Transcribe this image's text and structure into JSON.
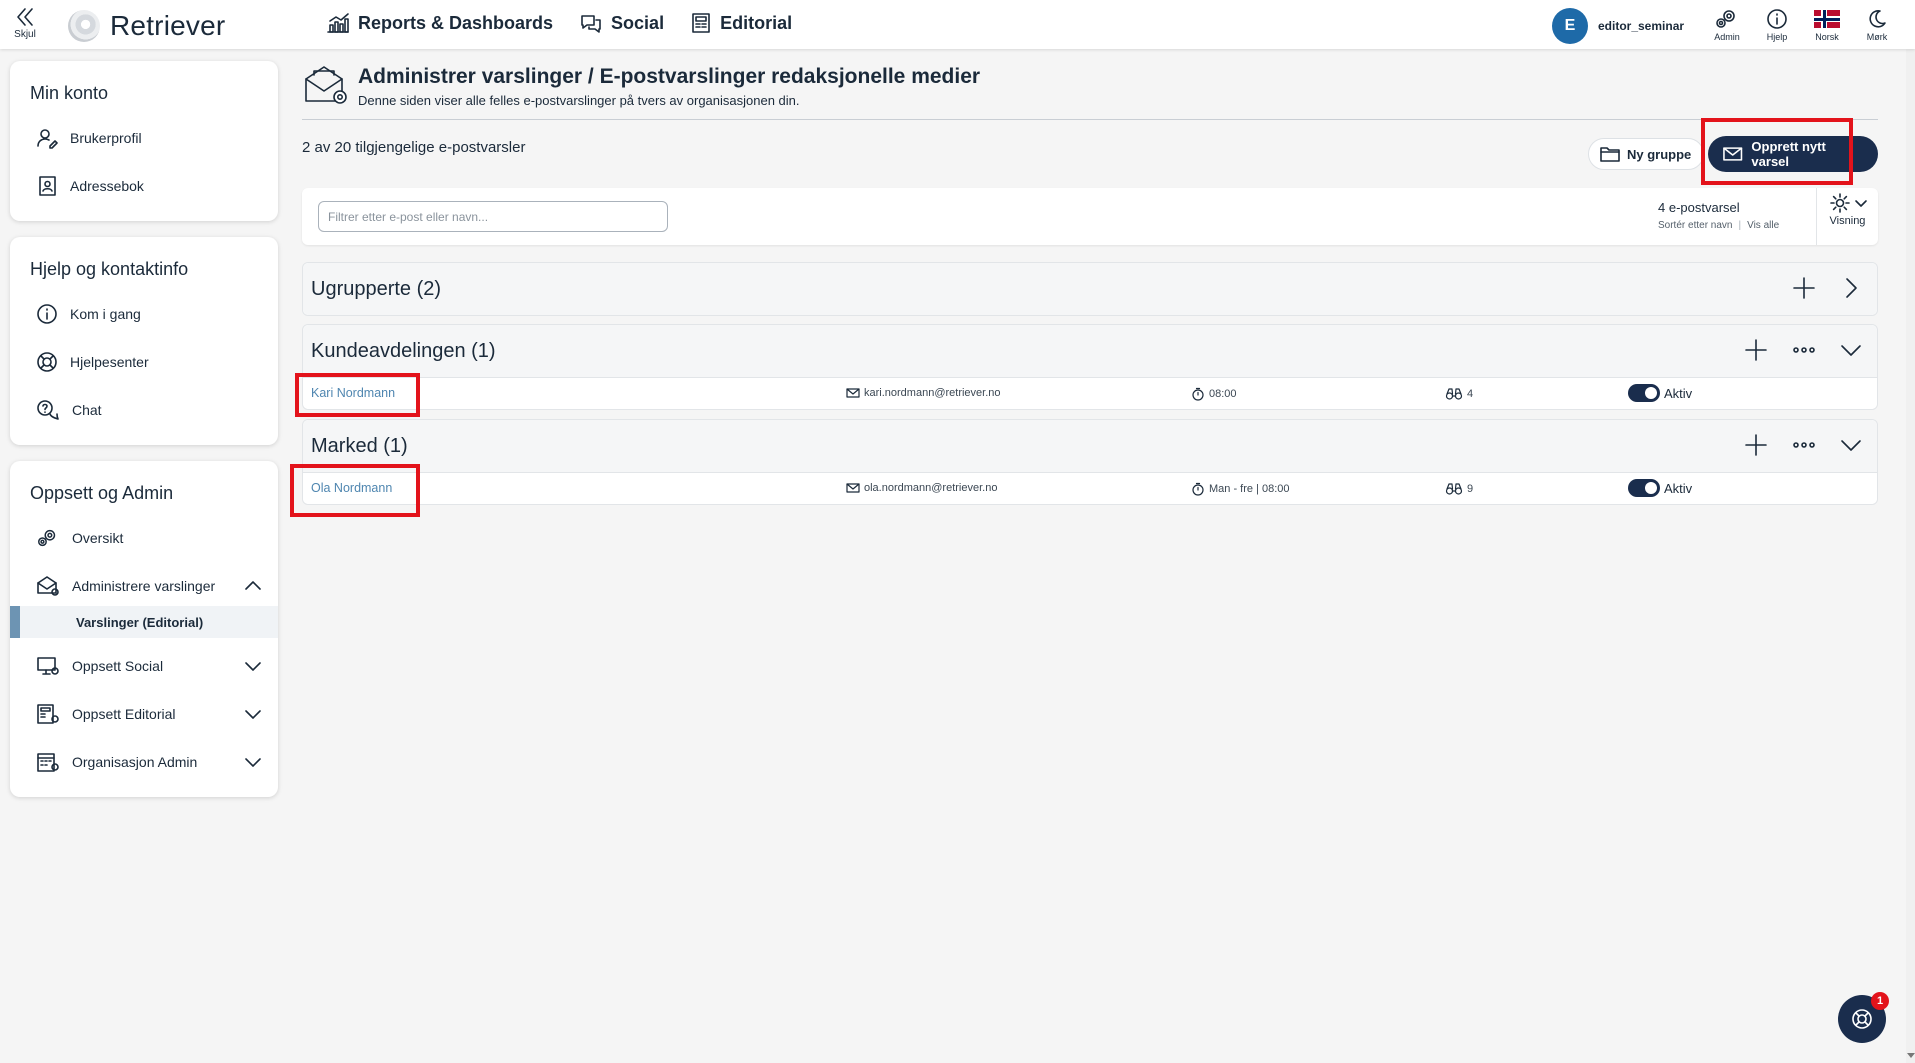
{
  "topbar": {
    "hide_label": "Skjul",
    "brand": "Retriever",
    "nav": [
      {
        "label": "Reports & Dashboards",
        "icon": "chart-icon"
      },
      {
        "label": "Social",
        "icon": "chat-bubbles-icon"
      },
      {
        "label": "Editorial",
        "icon": "newspaper-icon"
      }
    ],
    "user_initial": "E",
    "username": "editor_seminar",
    "actions": [
      {
        "label": "Admin",
        "icon": "gears-icon"
      },
      {
        "label": "Hjelp",
        "icon": "info-icon"
      },
      {
        "label": "Norsk",
        "icon": "norway-flag-icon"
      },
      {
        "label": "Mørk",
        "icon": "moon-icon"
      }
    ]
  },
  "sidebar": {
    "account": {
      "title": "Min konto",
      "items": [
        {
          "label": "Brukerprofil",
          "icon": "user-edit-icon"
        },
        {
          "label": "Adressebok",
          "icon": "address-book-icon"
        }
      ]
    },
    "help": {
      "title": "Hjelp og kontaktinfo",
      "items": [
        {
          "label": "Kom i gang",
          "icon": "info-icon"
        },
        {
          "label": "Hjelpesenter",
          "icon": "lifebuoy-icon"
        },
        {
          "label": "Chat",
          "icon": "chat-question-icon"
        }
      ]
    },
    "admin": {
      "title": "Oppsett og Admin",
      "items": [
        {
          "label": "Oversikt",
          "icon": "gears-icon"
        },
        {
          "label": "Administrere varslinger",
          "icon": "mail-gear-icon"
        },
        {
          "label": "Varslinger (Editorial)"
        },
        {
          "label": "Oppsett Social",
          "icon": "screen-gear-icon"
        },
        {
          "label": "Oppsett Editorial",
          "icon": "newspaper-gear-icon"
        },
        {
          "label": "Organisasjon Admin",
          "icon": "building-gear-icon"
        }
      ]
    }
  },
  "page": {
    "title": "Administrer varslinger / E-postvarslinger redaksjonelle medier",
    "description": "Denne siden viser alle felles e-postvarslinger på tvers av organisasjonen din.",
    "count_text": "2 av 20 tilgjengelige e-postvarsler",
    "new_group_label": "Ny gruppe",
    "create_label": "Opprett nytt varsel"
  },
  "filter": {
    "placeholder": "Filtrer etter e-post eller navn...",
    "count": "4 e-postvarsel",
    "sort_label": "Sortér etter navn",
    "show_all": "Vis alle",
    "view_label": "Visning"
  },
  "groups": [
    {
      "title": "Ugrupperte (2)",
      "collapsed": true,
      "rows": []
    },
    {
      "title": "Kundeavdelingen (1)",
      "collapsed": false,
      "rows": [
        {
          "name": "Kari Nordmann",
          "email": "kari.nordmann@retriever.no",
          "schedule": "08:00",
          "searches": "4",
          "status": "Aktiv"
        }
      ]
    },
    {
      "title": "Marked (1)",
      "collapsed": false,
      "rows": [
        {
          "name": "Ola Nordmann",
          "email": "ola.nordmann@retriever.no",
          "schedule": "Man - fre | 08:00",
          "searches": "9",
          "status": "Aktiv"
        }
      ]
    }
  ],
  "chat_badge": "1",
  "colors": {
    "accent": "#1a2d4d",
    "highlight": "#e3131b",
    "link": "#4f86b0",
    "avatar": "#1e6aa8"
  }
}
